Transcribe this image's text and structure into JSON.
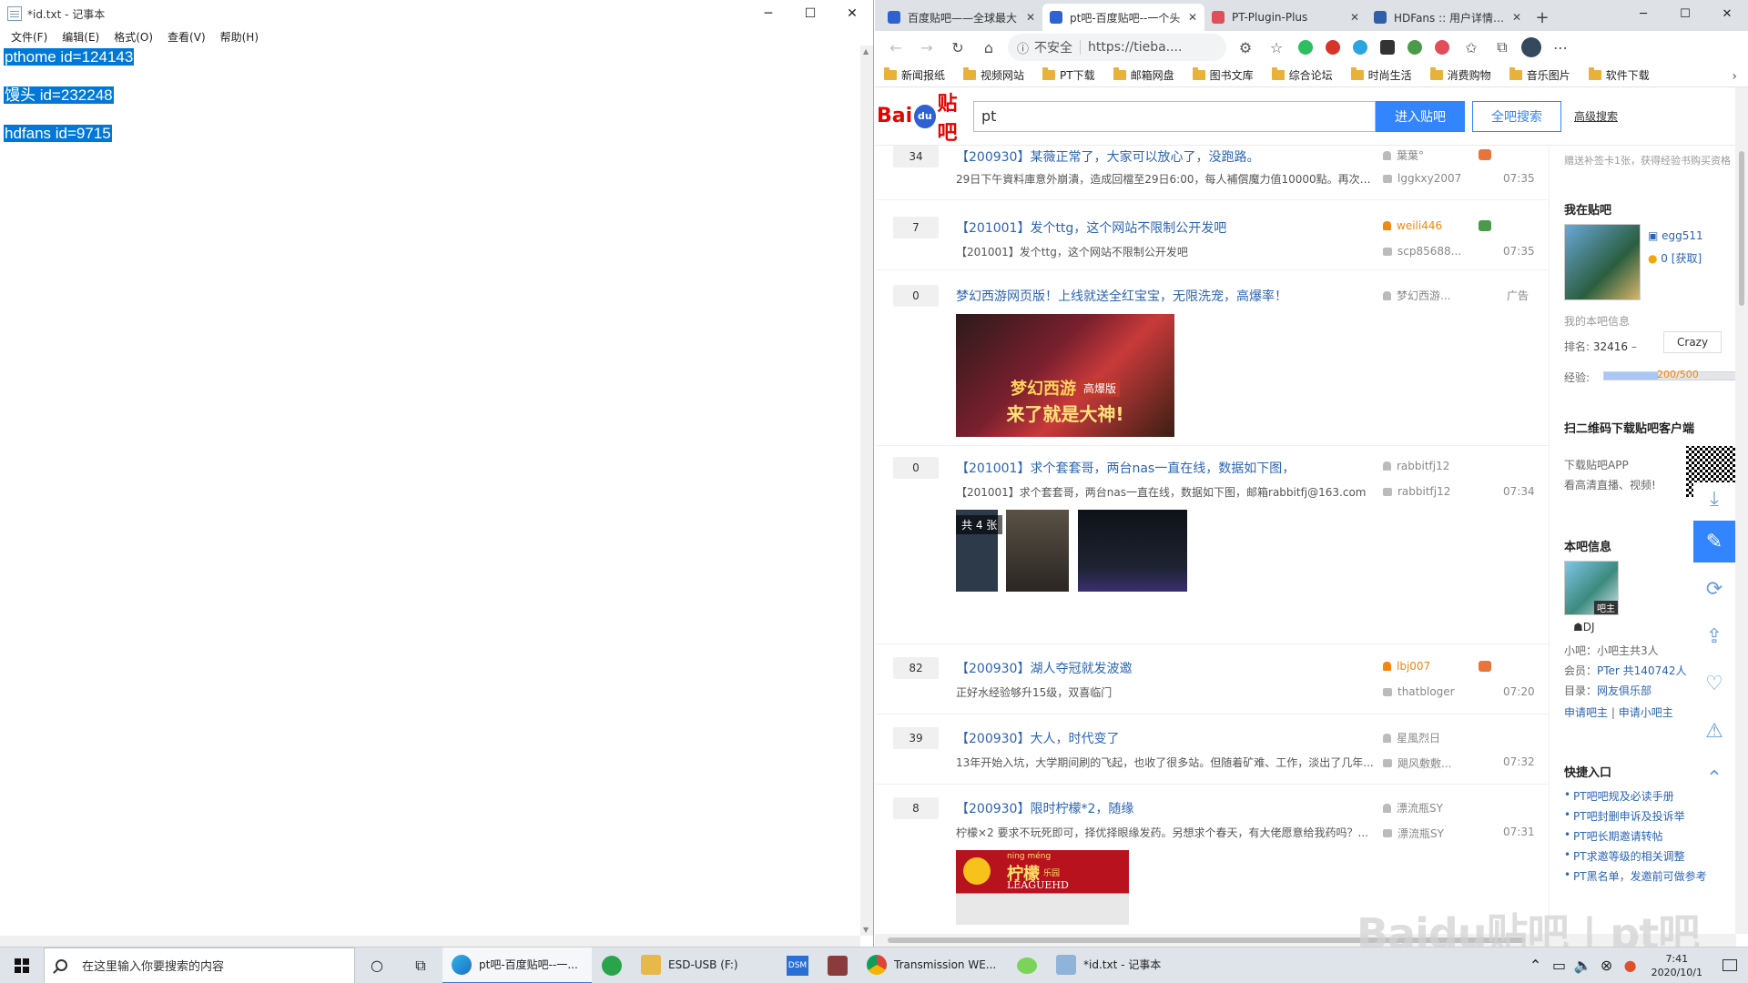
{
  "notepad": {
    "title": "*id.txt - 记事本",
    "menu": [
      "文件(F)",
      "编辑(E)",
      "格式(O)",
      "查看(V)",
      "帮助(H)"
    ],
    "lines": [
      "pthome id=124143",
      "馒头 id=232248",
      "hdfans id=9715"
    ]
  },
  "browser": {
    "tabs": [
      {
        "label": "百度贴吧——全球最大",
        "color": "#2e62d3"
      },
      {
        "label": "pt吧-百度贴吧--一个头",
        "color": "#2e62d3"
      },
      {
        "label": "PT-Plugin-Plus",
        "color": "#e04e5a"
      },
      {
        "label": "HDFans :: 用户详情 - 0",
        "color": "#2e5fa8"
      }
    ],
    "address": {
      "warning": "不安全",
      "url": "https://tieba...."
    },
    "bookmarks": [
      "新闻报纸",
      "视频网站",
      "PT下载",
      "邮箱网盘",
      "图书文库",
      "综合论坛",
      "时尚生活",
      "消费购物",
      "音乐图片",
      "软件下载"
    ]
  },
  "tieba": {
    "logo": {
      "left": "Bai",
      "paw": "du",
      "right": "贴吧"
    },
    "search_value": "pt",
    "btn_enter": "进入贴吧",
    "btn_search": "全吧搜索",
    "adv_search": "高级搜索",
    "threads": [
      {
        "replies": "34",
        "title": "【200930】某薇正常了，大家可以放心了，没跑路。",
        "desc": "29日下午資料庫意外崩潰，造成回檔至29日6:00，每人補償魔力值10000點。再次感...",
        "author": "葉葉°",
        "last": "lggkxy2007",
        "time": "07:35"
      },
      {
        "replies": "7",
        "title": "【201001】发个ttg，这个网站不限制公开发吧",
        "desc": "【201001】发个ttg，这个网站不限制公开发吧",
        "author": "weili446",
        "last": "scp85688...",
        "time": "07:35"
      },
      {
        "replies": "0",
        "title": "梦幻西游网页版！上线就送全红宝宝，无限洗宠，高爆率！",
        "author": "梦幻西游...",
        "ad": "广告",
        "ad_img_text": [
          "梦幻西游",
          "高爆版",
          "来了就是大神!"
        ]
      },
      {
        "replies": "0",
        "title": "【201001】求个套套哥，两台nas一直在线，数据如下图，",
        "desc": "【201001】求个套套哥，两台nas一直在线，数据如下图，邮箱rabbitfj@163.com",
        "author": "rabbitfj12",
        "last": "rabbitfj12",
        "time": "07:34",
        "img_count": "共 4 张"
      },
      {
        "replies": "82",
        "title": "【200930】湖人夺冠就发波邀",
        "desc": "正好水经验够升15级，双喜临门",
        "author": "lbj007",
        "last": "thatbloger",
        "time": "07:20"
      },
      {
        "replies": "39",
        "title": "【200930】大人，时代变了",
        "desc": "13年开始入坑，大学期间刷的飞起，也收了很多站。但随着矿难、工作，淡出了几年...",
        "author": "星風烈日",
        "last": "飓风敷敷...",
        "time": "07:32"
      },
      {
        "replies": "8",
        "title": "【200930】限时柠檬*2，随缘",
        "desc": "柠檬×2 要求不玩死即可，择优择眼缘发药。另想求个春天，有大佬愿意给我药吗？...",
        "author": "漂流瓶SY",
        "last": "漂流瓶SY",
        "time": "07:31",
        "img_text": [
          "ning méng",
          "柠檬",
          "乐园",
          "LEAGUEHD"
        ]
      }
    ],
    "sidebar": {
      "top_text": "赠送补签卡1张，获得经验书购买资格",
      "my_bar_title": "我在贴吧",
      "username": "egg511",
      "coins": "0",
      "get_label": "[获取]",
      "my_info": "我的本吧信息",
      "rank_label": "排名:",
      "rank_value": "32416",
      "level_name": "Crazy",
      "exp_label": "经验:",
      "exp_value": "200/500",
      "exp_progress": 0.4,
      "qr_title": "扫二维码下载贴吧客户端",
      "qr_line1": "下载贴吧APP",
      "qr_line2": "看高清直播、视频!",
      "bar_info_title": "本吧信息",
      "owner_badge": "吧主",
      "owner_name": "DJ",
      "sub_owner": "小吧：小吧主共3人",
      "member_label": "会员：",
      "member_value": "PTer 共140742人",
      "dir_label": "目录：",
      "dir_value": "网友俱乐部",
      "apply_owner": "申请吧主",
      "apply_sub": "申请小吧主",
      "quick_title": "快捷入口",
      "quick_links": [
        "PT吧吧规及必读手册",
        "PT吧封删申诉及投诉举",
        "PT吧长期邀请转帖",
        "PT求邀等级的相关调整",
        "PT黑名单，发邀前可做参考"
      ]
    },
    "watermark": "Baidu贴吧 | pt吧"
  },
  "taskbar": {
    "search_placeholder": "在这里输入你要搜索的内容",
    "apps": [
      "pt吧-百度贴吧--一...",
      "ESD-USB (F:)",
      "Transmission WE...",
      "*id.txt - 记事本"
    ],
    "time": "7:41",
    "date": "2020/10/1"
  }
}
